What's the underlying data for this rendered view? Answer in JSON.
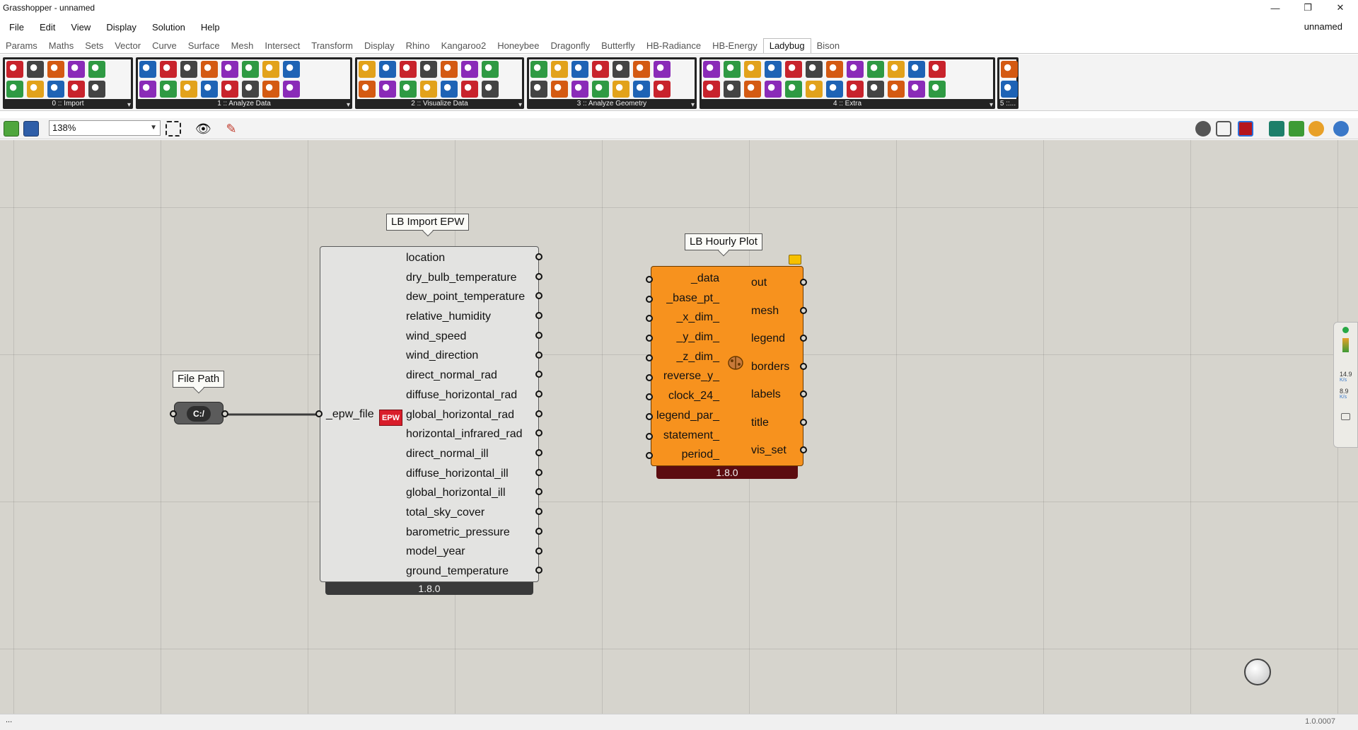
{
  "window": {
    "title": "Grasshopper - unnamed",
    "doc_name": "unnamed"
  },
  "menu": [
    "File",
    "Edit",
    "View",
    "Display",
    "Solution",
    "Help"
  ],
  "tabs": [
    "Params",
    "Maths",
    "Sets",
    "Vector",
    "Curve",
    "Surface",
    "Mesh",
    "Intersect",
    "Transform",
    "Display",
    "Rhino",
    "Kangaroo2",
    "Honeybee",
    "Dragonfly",
    "Butterfly",
    "HB-Radiance",
    "HB-Energy",
    "Ladybug",
    "Bison"
  ],
  "active_tab": "Ladybug",
  "ribbon_groups": [
    {
      "label": "0 :: Import",
      "cols": 5
    },
    {
      "label": "1 :: Analyze Data",
      "cols": 8
    },
    {
      "label": "2 :: Visualize Data",
      "cols": 7
    },
    {
      "label": "3 :: Analyze Geometry",
      "cols": 7
    },
    {
      "label": "4 :: Extra",
      "cols": 12
    },
    {
      "label": "5 ::...",
      "cols": 1
    }
  ],
  "canvas_toolbar": {
    "zoom": "138%"
  },
  "file_path": {
    "label": "File Path",
    "icon_text": "C:/"
  },
  "epw_component": {
    "title": "LB Import EPW",
    "input": "_epw_file",
    "icon_text": "EPW",
    "outputs": [
      "location",
      "dry_bulb_temperature",
      "dew_point_temperature",
      "relative_humidity",
      "wind_speed",
      "wind_direction",
      "direct_normal_rad",
      "diffuse_horizontal_rad",
      "global_horizontal_rad",
      "horizontal_infrared_rad",
      "direct_normal_ill",
      "diffuse_horizontal_ill",
      "global_horizontal_ill",
      "total_sky_cover",
      "barometric_pressure",
      "model_year",
      "ground_temperature"
    ],
    "version": "1.8.0"
  },
  "plot_component": {
    "title": "LB Hourly Plot",
    "inputs": [
      "_data",
      "_base_pt_",
      "_x_dim_",
      "_y_dim_",
      "_z_dim_",
      "reverse_y_",
      "clock_24_",
      "legend_par_",
      "statement_",
      "period_"
    ],
    "outputs": [
      "out",
      "mesh",
      "legend",
      "borders",
      "labels",
      "title",
      "vis_set"
    ],
    "version": "1.8.0"
  },
  "side_widget": {
    "top_value": "14.9",
    "top_unit": "K/s",
    "bottom_value": "8.9",
    "bottom_unit": "K/s"
  },
  "status": {
    "left": "...",
    "right": "1.0.0007"
  },
  "colors": {
    "canvas": "#d6d4cd",
    "plot_component": "#f7921e",
    "epw_component": "#e3e3e1",
    "epw_icon": "#d91d2a",
    "group_bg": "#232323"
  },
  "icons": [
    "minimize-icon",
    "restore-icon",
    "close-icon",
    "open-file-icon",
    "save-icon",
    "zoom-extents-icon",
    "preview-eye-icon",
    "sketch-icon",
    "warning-icon"
  ]
}
